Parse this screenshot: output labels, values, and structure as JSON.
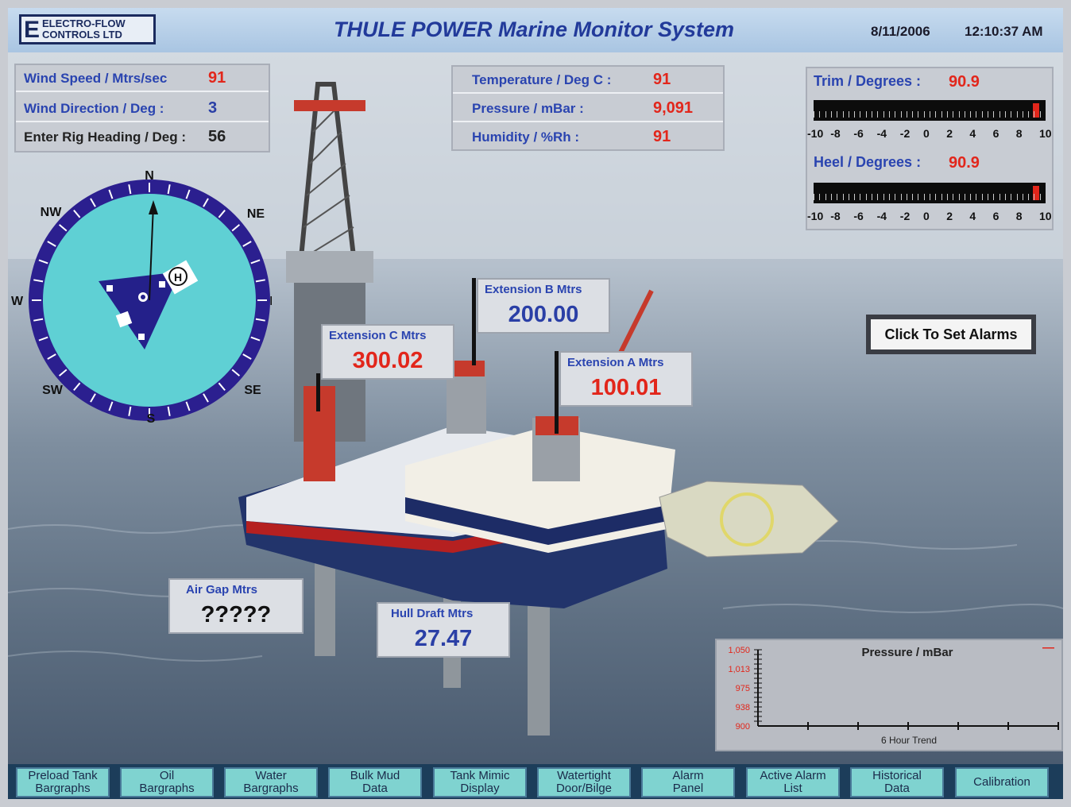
{
  "header": {
    "logo_letter": "E",
    "logo_line1": "ELECTRO-FLOW",
    "logo_line2": "CONTROLS LTD",
    "title": "THULE POWER Marine Monitor System",
    "date": "8/11/2006",
    "time": "12:10:37 AM"
  },
  "wind": {
    "speed_label": "Wind Speed / Mtrs/sec",
    "speed_value": "91",
    "direction_label": "Wind Direction / Deg :",
    "direction_value": "3",
    "heading_label": "Enter Rig Heading / Deg :",
    "heading_value": "56"
  },
  "weather": {
    "temp_label": "Temperature / Deg C :",
    "temp_value": "91",
    "pressure_label": "Pressure / mBar :",
    "pressure_value": "9,091",
    "humidity_label": "Humidity / %Rh :",
    "humidity_value": "91"
  },
  "trim": {
    "label": "Trim / Degrees :",
    "value": "90.9",
    "scale": [
      "-10",
      "-8",
      "-6",
      "-4",
      "-2",
      "0",
      "2",
      "4",
      "6",
      "8",
      "10"
    ],
    "level_fraction": 0.98
  },
  "heel": {
    "label": "Heel / Degrees :",
    "value": "90.9",
    "scale": [
      "-10",
      "-8",
      "-6",
      "-4",
      "-2",
      "0",
      "2",
      "4",
      "6",
      "8",
      "10"
    ],
    "level_fraction": 0.98
  },
  "compass": {
    "n": "N",
    "ne": "NE",
    "e": "E",
    "se": "SE",
    "s": "S",
    "sw": "SW",
    "w": "W",
    "nw": "NW",
    "helipad": "H"
  },
  "extensions": {
    "c_label": "Extension C  Mtrs",
    "c_value": "300.02",
    "b_label": "Extension B  Mtrs",
    "b_value": "200.00",
    "a_label": "Extension A  Mtrs",
    "a_value": "100.01"
  },
  "alarms": {
    "button_label": "Click To Set Alarms"
  },
  "air_gap": {
    "label": "Air Gap Mtrs",
    "value": "?????"
  },
  "hull_draft": {
    "label": "Hull Draft  Mtrs",
    "value": "27.47"
  },
  "chart_data": {
    "type": "line",
    "title": "Pressure / mBar",
    "xlabel": "6 Hour Trend",
    "ylabel": "",
    "yticks": [
      "1,050",
      "1,013",
      "975",
      "938",
      "900"
    ],
    "ylim": [
      900,
      1050
    ],
    "series": [],
    "legend_marker": "—"
  },
  "nav": [
    {
      "line1": "Preload Tank",
      "line2": "Bargraphs"
    },
    {
      "line1": "Oil",
      "line2": "Bargraphs"
    },
    {
      "line1": "Water",
      "line2": "Bargraphs"
    },
    {
      "line1": "Bulk Mud",
      "line2": "Data"
    },
    {
      "line1": "Tank Mimic",
      "line2": "Display"
    },
    {
      "line1": "Watertight",
      "line2": "Door/Bilge"
    },
    {
      "line1": "Alarm",
      "line2": "Panel"
    },
    {
      "line1": "Active Alarm",
      "line2": "List"
    },
    {
      "line1": "Historical",
      "line2": "Data"
    },
    {
      "line1": "Calibration",
      "line2": ""
    }
  ],
  "colors": {
    "accent_red": "#e2261b",
    "accent_blue": "#2a44b0",
    "compass_ring": "#2b1f8f",
    "compass_face": "#5fd0d4",
    "nav_button": "#7fd3d0"
  }
}
